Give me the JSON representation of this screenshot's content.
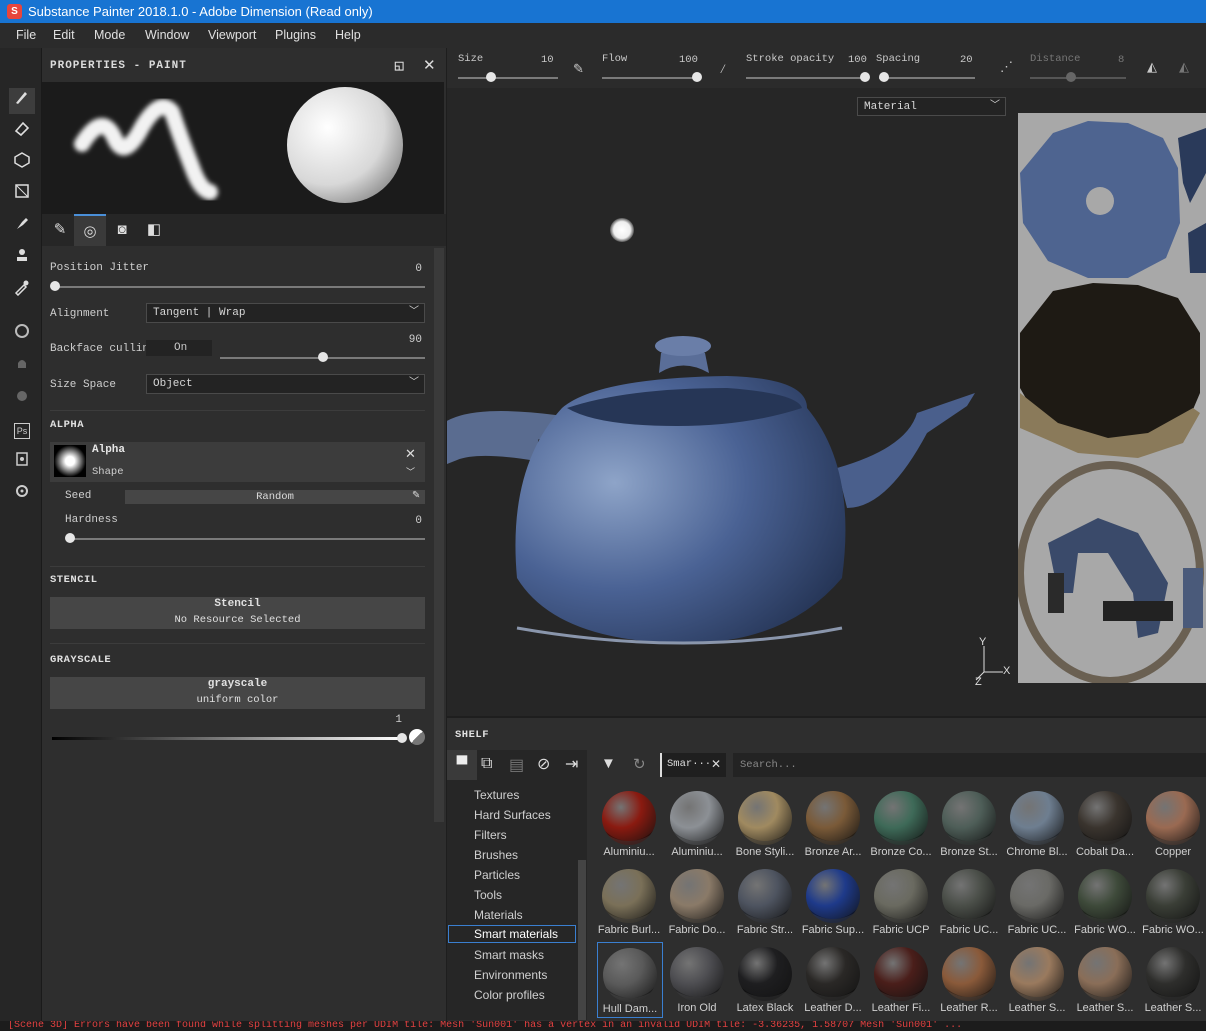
{
  "window": {
    "title": "Substance Painter 2018.1.0 - Adobe Dimension (Read only)",
    "logo": "S"
  },
  "menu": [
    "File",
    "Edit",
    "Mode",
    "Window",
    "Viewport",
    "Plugins",
    "Help"
  ],
  "properties": {
    "title": "PROPERTIES - PAINT",
    "position_jitter": {
      "label": "Position Jitter",
      "value": "0"
    },
    "alignment": {
      "label": "Alignment",
      "value": "Tangent | Wrap"
    },
    "backface": {
      "label": "Backface culling",
      "state": "On",
      "value": "90"
    },
    "size_space": {
      "label": "Size Space",
      "value": "Object"
    },
    "alpha": {
      "section": "ALPHA",
      "name": "Alpha",
      "sub": "Shape",
      "seed_label": "Seed",
      "seed_value": "Random",
      "hardness_label": "Hardness",
      "hardness_value": "0"
    },
    "stencil": {
      "section": "STENCIL",
      "name": "Stencil",
      "sub": "No Resource Selected"
    },
    "grayscale": {
      "section": "GRAYSCALE",
      "name": "grayscale",
      "sub": "uniform color",
      "value": "1"
    }
  },
  "toolbar": {
    "size": {
      "label": "Size",
      "value": "10"
    },
    "flow": {
      "label": "Flow",
      "value": "100"
    },
    "stroke_opacity": {
      "label": "Stroke opacity",
      "value": "100"
    },
    "spacing": {
      "label": "Spacing",
      "value": "20"
    },
    "distance": {
      "label": "Distance",
      "value": "8"
    }
  },
  "viewport": {
    "mode": "Material",
    "axis_y": "Y",
    "axis_x": "X",
    "axis_z": "Z"
  },
  "shelf": {
    "title": "SHELF",
    "filter_tag": "Smar···",
    "search_placeholder": "Search...",
    "categories": [
      "Textures",
      "Hard Surfaces",
      "Filters",
      "Brushes",
      "Particles",
      "Tools",
      "Materials",
      "Smart materials",
      "Smart masks",
      "Environments",
      "Color profiles"
    ],
    "selected_category": "Smart materials",
    "items": [
      {
        "label": "Aluminiu...",
        "color": "#8a1a10"
      },
      {
        "label": "Aluminiu...",
        "color": "#8c9095"
      },
      {
        "label": "Bone Styli...",
        "color": "#a08a60"
      },
      {
        "label": "Bronze Ar...",
        "color": "#7a5a38"
      },
      {
        "label": "Bronze Co...",
        "color": "#3e6a58"
      },
      {
        "label": "Bronze St...",
        "color": "#4e5e58"
      },
      {
        "label": "Chrome Bl...",
        "color": "#6e7e90"
      },
      {
        "label": "Cobalt Da...",
        "color": "#3a342e"
      },
      {
        "label": "Copper",
        "color": "#9a6a52"
      },
      {
        "label": "Fabric Burl...",
        "color": "#7a7058"
      },
      {
        "label": "Fabric Do...",
        "color": "#8a7a68"
      },
      {
        "label": "Fabric Str...",
        "color": "#4e5460"
      },
      {
        "label": "Fabric Sup...",
        "color": "#1e3a8a"
      },
      {
        "label": "Fabric UCP",
        "color": "#6a6a60"
      },
      {
        "label": "Fabric UC...",
        "color": "#4a4e48"
      },
      {
        "label": "Fabric UC...",
        "color": "#6a6a66"
      },
      {
        "label": "Fabric WO...",
        "color": "#3e4a3a"
      },
      {
        "label": "Fabric WO...",
        "color": "#3a3e36"
      },
      {
        "label": "Hull Dam...",
        "color": "#5a5a5a"
      },
      {
        "label": "Iron Old",
        "color": "#4e4e52"
      },
      {
        "label": "Latex Black",
        "color": "#1e1e20"
      },
      {
        "label": "Leather D...",
        "color": "#2a2826"
      },
      {
        "label": "Leather Fi...",
        "color": "#4a1e1a"
      },
      {
        "label": "Leather R...",
        "color": "#8a5a3a"
      },
      {
        "label": "Leather S...",
        "color": "#9a7a5e"
      },
      {
        "label": "Leather S...",
        "color": "#8a6e58"
      },
      {
        "label": "Leather S...",
        "color": "#2e2e2c"
      }
    ]
  },
  "status": "[Scene 3D] Errors have been found while splitting meshes per UDIM tile: Mesh 'Sun001' has a vertex in an invalid UDIM tile: -3.36235, 1.58707 Mesh 'Sun001' ..."
}
